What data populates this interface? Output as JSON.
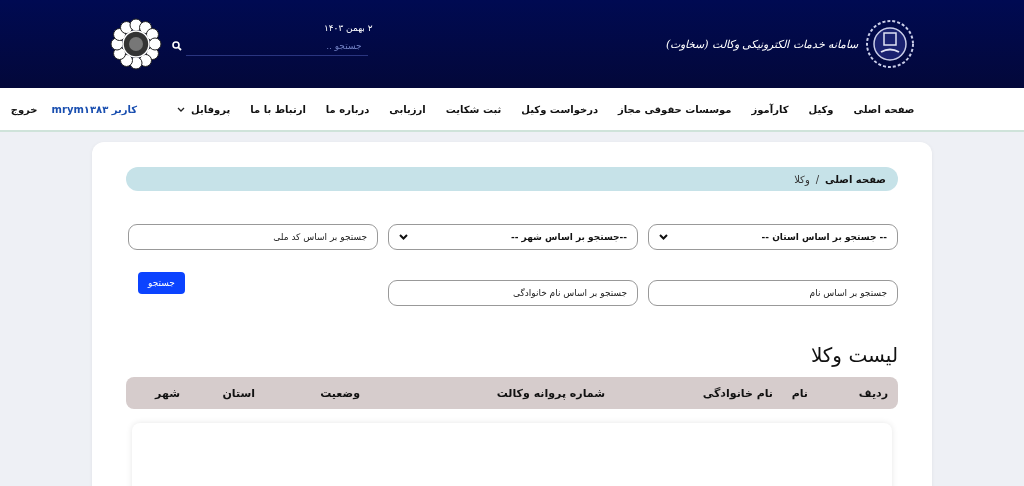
{
  "header": {
    "title": "سامانه خدمات الکترونیکی وکالت (سخاوت)",
    "date": "۲ بهمن ۱۴۰۳",
    "search": {
      "placeholder": "جستجو .."
    }
  },
  "nav": {
    "items": [
      "صفحه اصلی",
      "وکیل",
      "کارآموز",
      "موسسات حقوقی مجاز",
      "درخواست وکیل",
      "ثبت شکایت",
      "ارزیابی",
      "درباره ما",
      "ارتباط با ما"
    ],
    "profile": "پروفایل",
    "user": "کاربر mrym۱۳۸۳",
    "logout": "خروج"
  },
  "breadcrumb": {
    "separator": "/",
    "items": [
      "صفحه اصلی",
      "وکلا"
    ]
  },
  "filters": [
    {
      "kind": "select",
      "value": "-- جستجو بر اساس استان --"
    },
    {
      "kind": "select",
      "value": "--جستجو بر اساس شهر --"
    },
    {
      "kind": "input",
      "placeholder": "جستجو بر اساس کد ملی"
    },
    {
      "kind": "input",
      "placeholder": "جستجو بر اساس نام"
    },
    {
      "kind": "input",
      "placeholder": "جستجو بر اساس نام خانوادگی"
    },
    {
      "kind": "button",
      "label": "جستجو"
    }
  ],
  "list": {
    "title": "لیست وکلا",
    "columns": [
      "ردیف",
      "نام",
      "نام خانوادگی",
      "شماره پروانه وکالت",
      "وضعیت",
      "استان",
      "شهر"
    ]
  }
}
